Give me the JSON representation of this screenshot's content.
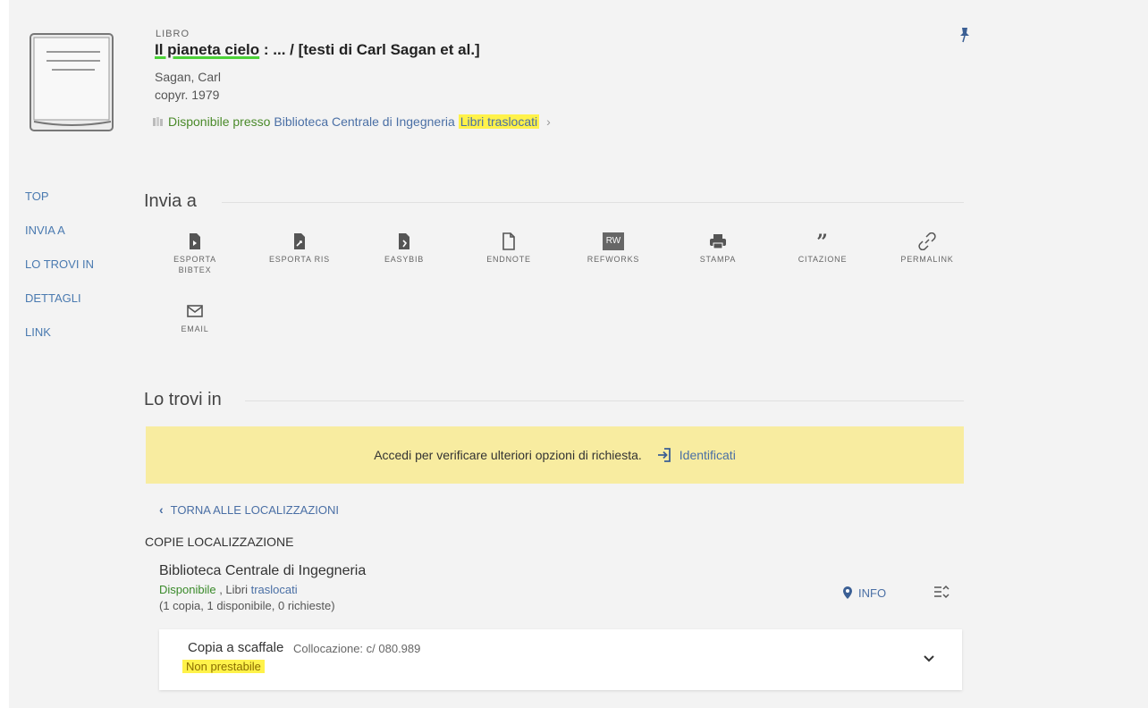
{
  "record": {
    "type": "LIBRO",
    "title_main": "Il pianeta cielo",
    "title_rest": " : ... / [testi di Carl Sagan et al.]",
    "author": "Sagan, Carl",
    "date": "copyr. 1979",
    "availability": {
      "status": "Disponibile presso",
      "library": "Biblioteca Centrale di Ingegneria",
      "location": "Libri traslocati"
    }
  },
  "sidenav": [
    "TOP",
    "INVIA A",
    "LO TROVI IN",
    "DETTAGLI",
    "LINK"
  ],
  "send_to": {
    "title": "Invia a",
    "actions": [
      {
        "label": "ESPORTA BIBTEX",
        "icon": "bibtex-icon"
      },
      {
        "label": "ESPORTA RIS",
        "icon": "ris-icon"
      },
      {
        "label": "EASYBIB",
        "icon": "easybib-icon"
      },
      {
        "label": "ENDNOTE",
        "icon": "endnote-icon"
      },
      {
        "label": "REFWORKS",
        "icon": "refworks-icon"
      },
      {
        "label": "STAMPA",
        "icon": "print-icon"
      },
      {
        "label": "CITAZIONE",
        "icon": "quote-icon"
      },
      {
        "label": "PERMALINK",
        "icon": "link-icon"
      },
      {
        "label": "EMAIL",
        "icon": "email-icon"
      }
    ],
    "refworks_badge": "RW"
  },
  "find_in": {
    "title": "Lo trovi in",
    "banner": {
      "text": "Accedi per verificare ulteriori opzioni di richiesta.",
      "login": "Identificati"
    },
    "back": "TORNA ALLE LOCALIZZAZIONI",
    "copies_label": "COPIE LOCALIZZAZIONE",
    "library": {
      "name": "Biblioteca Centrale di Ingegneria",
      "status": "Disponibile",
      "separator": " , Libri ",
      "location": "traslocati",
      "counts": "(1 copia, 1 disponibile, 0 richieste)",
      "info": "INFO"
    },
    "item": {
      "type": "Copia a scaffale",
      "call_number": "Collocazione: c/ 080.989",
      "policy": "Non prestabile"
    }
  },
  "colors": {
    "accent": "#4a6fa5",
    "available": "#4a8a2a",
    "highlight": "#fff24a",
    "banner": "#f8eca0"
  }
}
